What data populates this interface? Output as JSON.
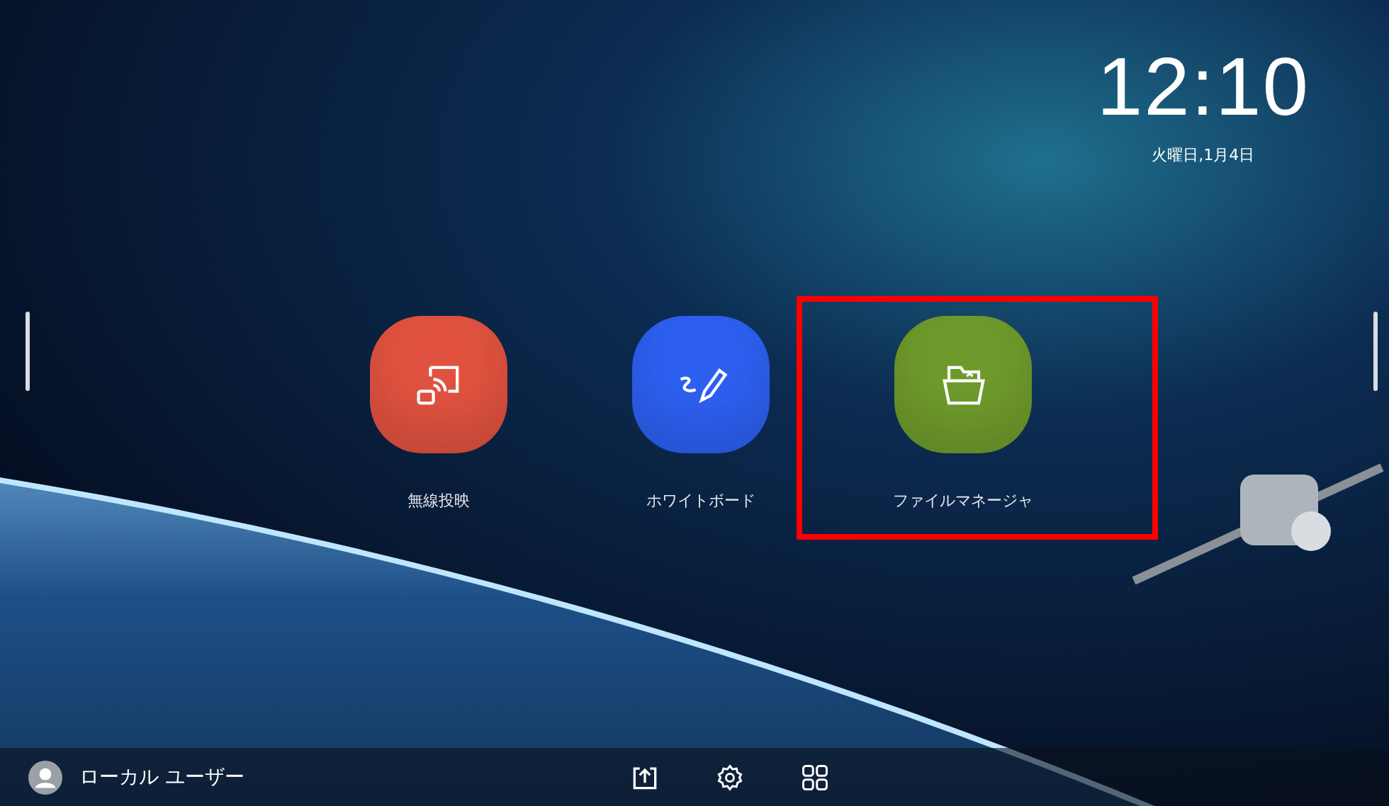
{
  "clock": {
    "time": "12:10",
    "date": "火曜日,1月4日"
  },
  "apps": [
    {
      "label": "無線投映",
      "kind": "cast",
      "color": "#e0523f",
      "highlighted": false
    },
    {
      "label": "ホワイトボード",
      "kind": "whiteboard",
      "color": "#2d5ff0",
      "highlighted": false
    },
    {
      "label": "ファイルマネージャ",
      "kind": "files",
      "color": "#6e9a2b",
      "highlighted": true
    }
  ],
  "bottom_bar": {
    "user": "ローカル ユーザー"
  }
}
